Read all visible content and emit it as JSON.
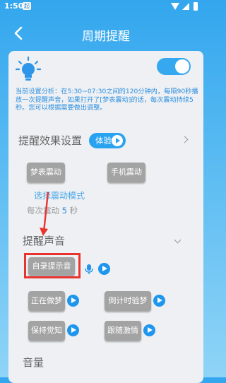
{
  "status": {
    "time": "1:50",
    "app_badge": "起"
  },
  "header": {
    "title": "周期提醒"
  },
  "reminder": {
    "enabled": true,
    "analysis_text": "当前设置分析：在5:30~07:30之间的120分钟内，每隔90秒播放一次提醒声音，如果打开了[梦表震动]的话，每次震动持续5秒。您可以根据需要做出调整。"
  },
  "effect": {
    "section_title": "提醒效果设置",
    "try_label": "体验",
    "dream_watch_vibrate": "梦表震动",
    "phone_vibrate": "手机震动",
    "hint": "选择震动模式",
    "vibrate_prefix": "每次震动",
    "vibrate_seconds": "5",
    "vibrate_unit": "秒"
  },
  "sound": {
    "section_title": "提醒声音",
    "custom_record": "自录提示音",
    "items": [
      "正在做梦",
      "倒计时验梦",
      "保持觉知",
      "跟随激情"
    ]
  },
  "volume": {
    "section_title": "音量"
  },
  "colors": {
    "primary": "#29a3f0",
    "highlight_box": "#e8332f",
    "button_gray": "#a3a3a3"
  }
}
